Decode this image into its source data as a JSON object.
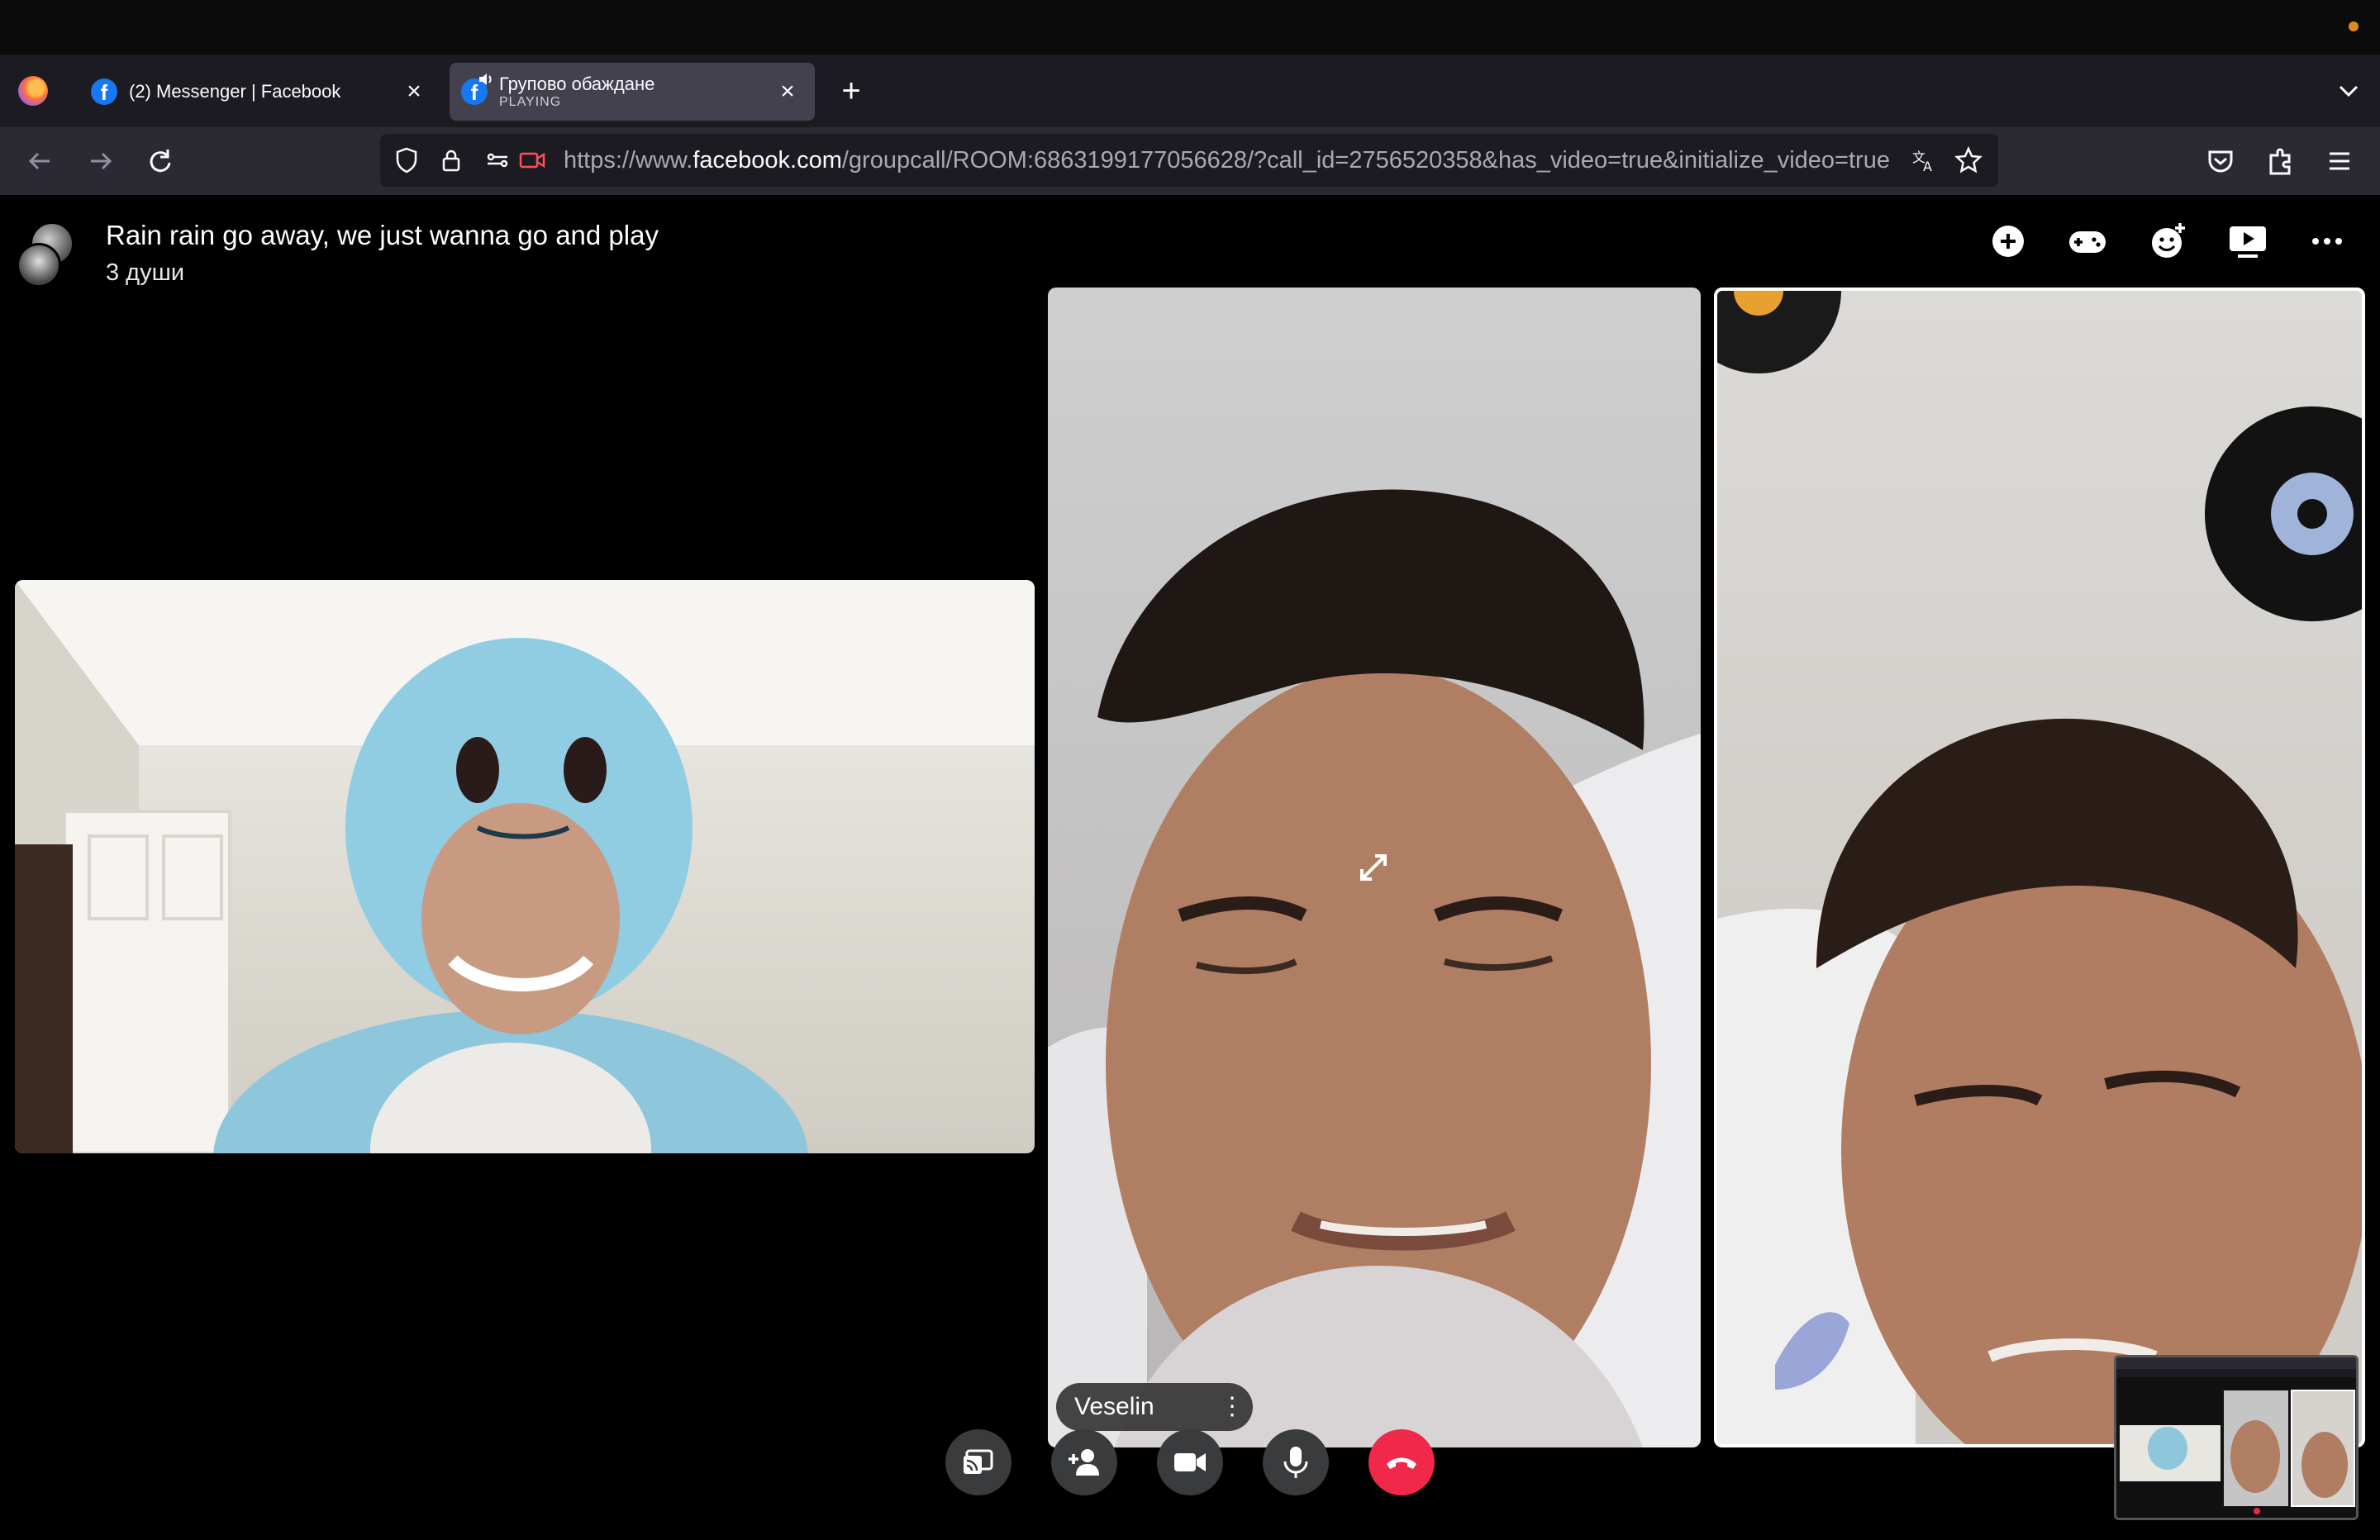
{
  "browser": {
    "tabs": [
      {
        "title": "(2) Messenger | Facebook",
        "active": false
      },
      {
        "title": "Групово обаждане",
        "subtitle": "PLAYING",
        "active": true
      }
    ],
    "url": {
      "prefix": "https://www.",
      "domain": "facebook.com",
      "path": "/groupcall/ROOM:6863199177056628/?call_id=2756520358&has_video=true&initialize_video=true"
    }
  },
  "call": {
    "title": "Rain rain go away, we just wanna go and play",
    "participants_label": "3 души",
    "header_actions": [
      "add-icon",
      "games-icon",
      "effects-icon",
      "watch-together-icon",
      "more-icon"
    ],
    "speaker_name": "Veselin",
    "controls": [
      "share-screen-icon",
      "add-person-icon",
      "video-camera-icon",
      "microphone-icon",
      "end-call-icon"
    ]
  },
  "colors": {
    "end_call": "#f02849",
    "control_bg": "#3a3b3c",
    "facebook_blue": "#1877f2",
    "status_dot": "#e08a1e"
  }
}
